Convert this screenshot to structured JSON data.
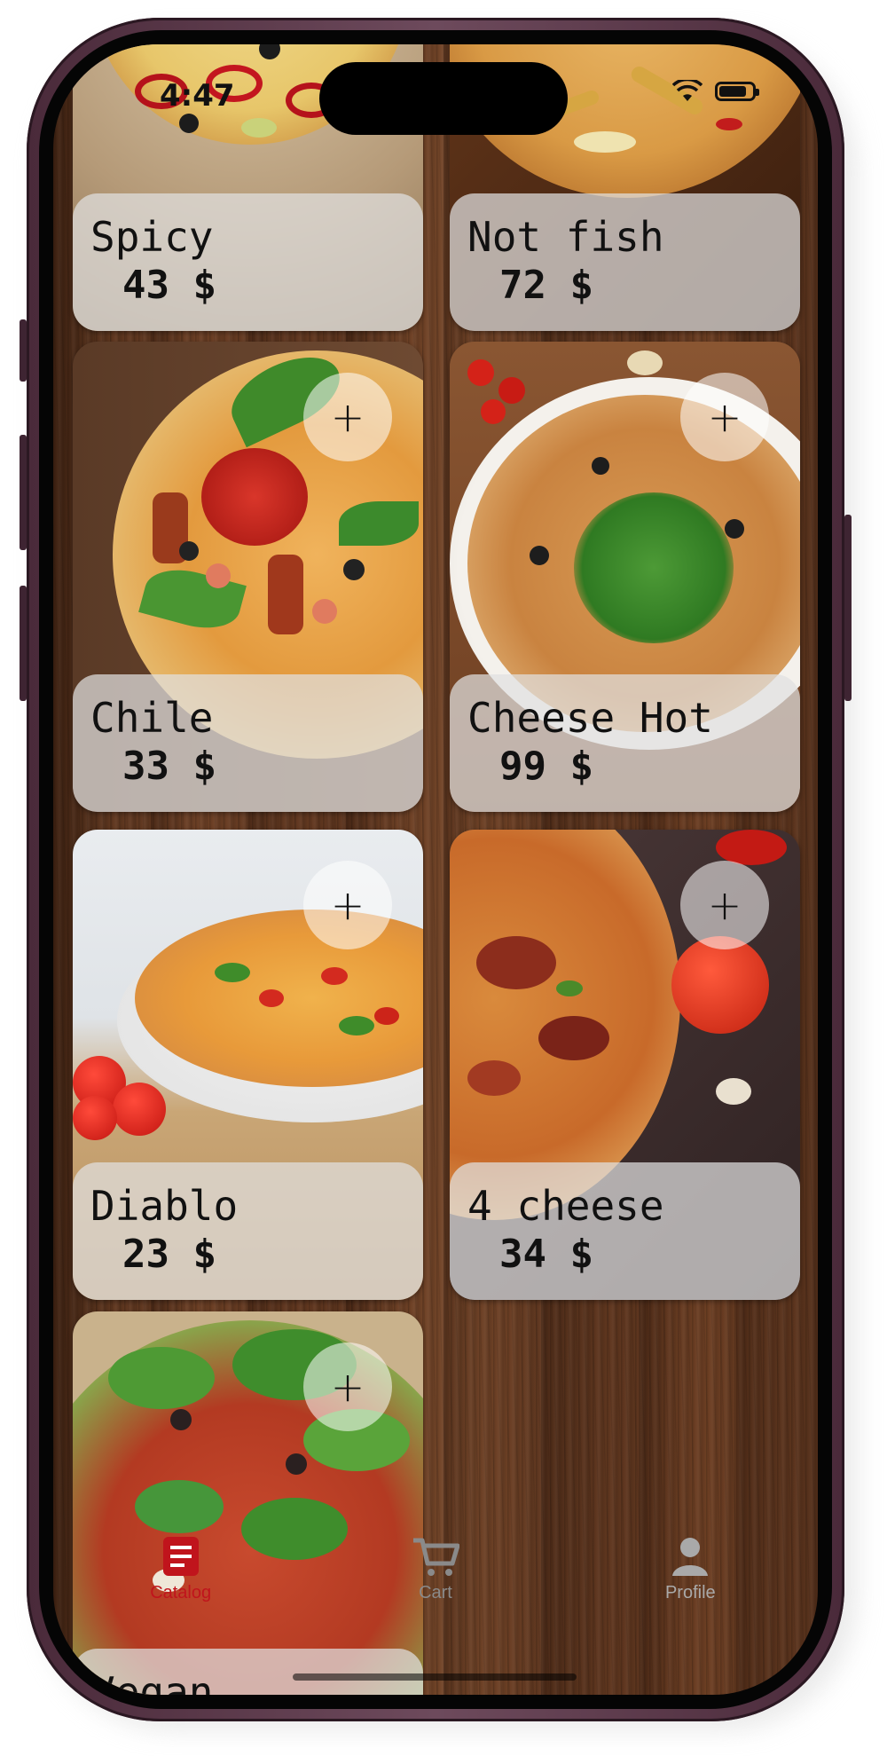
{
  "status_bar": {
    "time": "4:47"
  },
  "menu": {
    "items": [
      {
        "name": "Spicy",
        "price": "43 $",
        "add": "+"
      },
      {
        "name": "Not fish",
        "price": "72 $",
        "add": "+"
      },
      {
        "name": "Chile",
        "price": "33 $",
        "add": "+"
      },
      {
        "name": "Cheese Hot",
        "price": "99 $",
        "add": "+"
      },
      {
        "name": "Diablo",
        "price": "23 $",
        "add": "+"
      },
      {
        "name": "4 cheese",
        "price": "34 $",
        "add": "+"
      },
      {
        "name": "Vegan",
        "price": "",
        "add": "+"
      }
    ]
  },
  "tabbar": {
    "tabs": [
      {
        "label": "Catalog",
        "icon": "catalog-icon",
        "active": true
      },
      {
        "label": "Cart",
        "icon": "cart-icon",
        "active": false
      },
      {
        "label": "Profile",
        "icon": "profile-icon",
        "active": false
      }
    ],
    "active_color": "#c0141c",
    "inactive_color": "#8a8a8a"
  }
}
